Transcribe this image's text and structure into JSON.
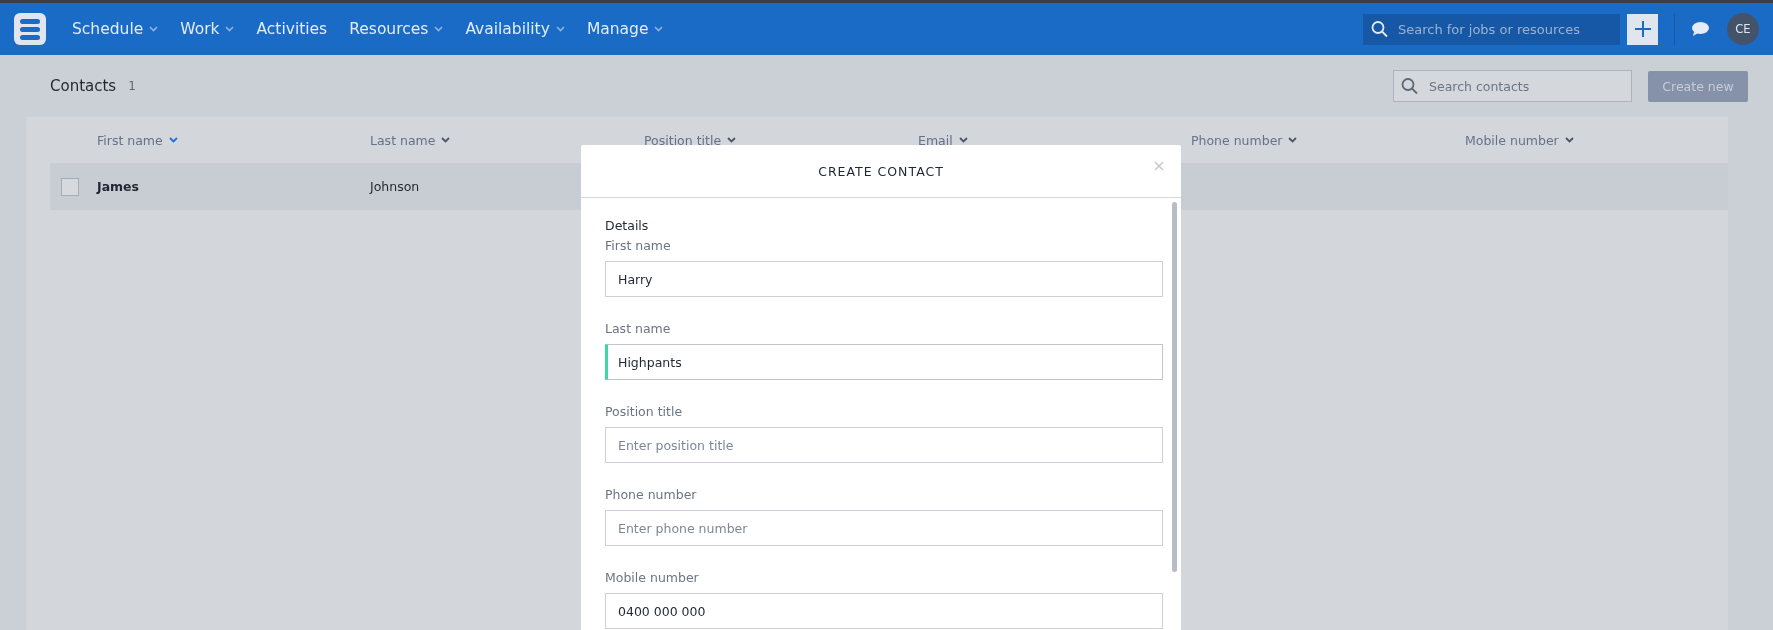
{
  "nav": {
    "items": [
      {
        "label": "Schedule",
        "dropdown": true
      },
      {
        "label": "Work",
        "dropdown": true
      },
      {
        "label": "Activities",
        "dropdown": false
      },
      {
        "label": "Resources",
        "dropdown": true
      },
      {
        "label": "Availability",
        "dropdown": true
      },
      {
        "label": "Manage",
        "dropdown": true
      }
    ],
    "search": {
      "placeholder": "Search for jobs or resources"
    },
    "avatar": "CE"
  },
  "page": {
    "title": "Contacts",
    "count": "1",
    "search": {
      "placeholder": "Search contacts"
    },
    "create_button": "Create new"
  },
  "table": {
    "columns": [
      {
        "label": "First name",
        "selected": true
      },
      {
        "label": "Last name",
        "selected": false
      },
      {
        "label": "Position title",
        "selected": false
      },
      {
        "label": "Email",
        "selected": false
      },
      {
        "label": "Phone number",
        "selected": false
      },
      {
        "label": "Mobile number",
        "selected": false
      }
    ],
    "rows": [
      {
        "checked": false,
        "cells": [
          "James",
          "Johnson"
        ]
      }
    ]
  },
  "modal": {
    "title": "CREATE CONTACT",
    "section": "Details",
    "fields": [
      {
        "label": "First name",
        "value": "Harry",
        "focused": false
      },
      {
        "label": "Last name",
        "value": "Highpants",
        "focused": true
      },
      {
        "label": "Position title",
        "placeholder": "Enter position title",
        "focused": false
      },
      {
        "label": "Phone number",
        "placeholder": "Enter phone number",
        "focused": false
      },
      {
        "label": "Mobile number",
        "value": "0400 000 000",
        "focused": false
      }
    ]
  }
}
